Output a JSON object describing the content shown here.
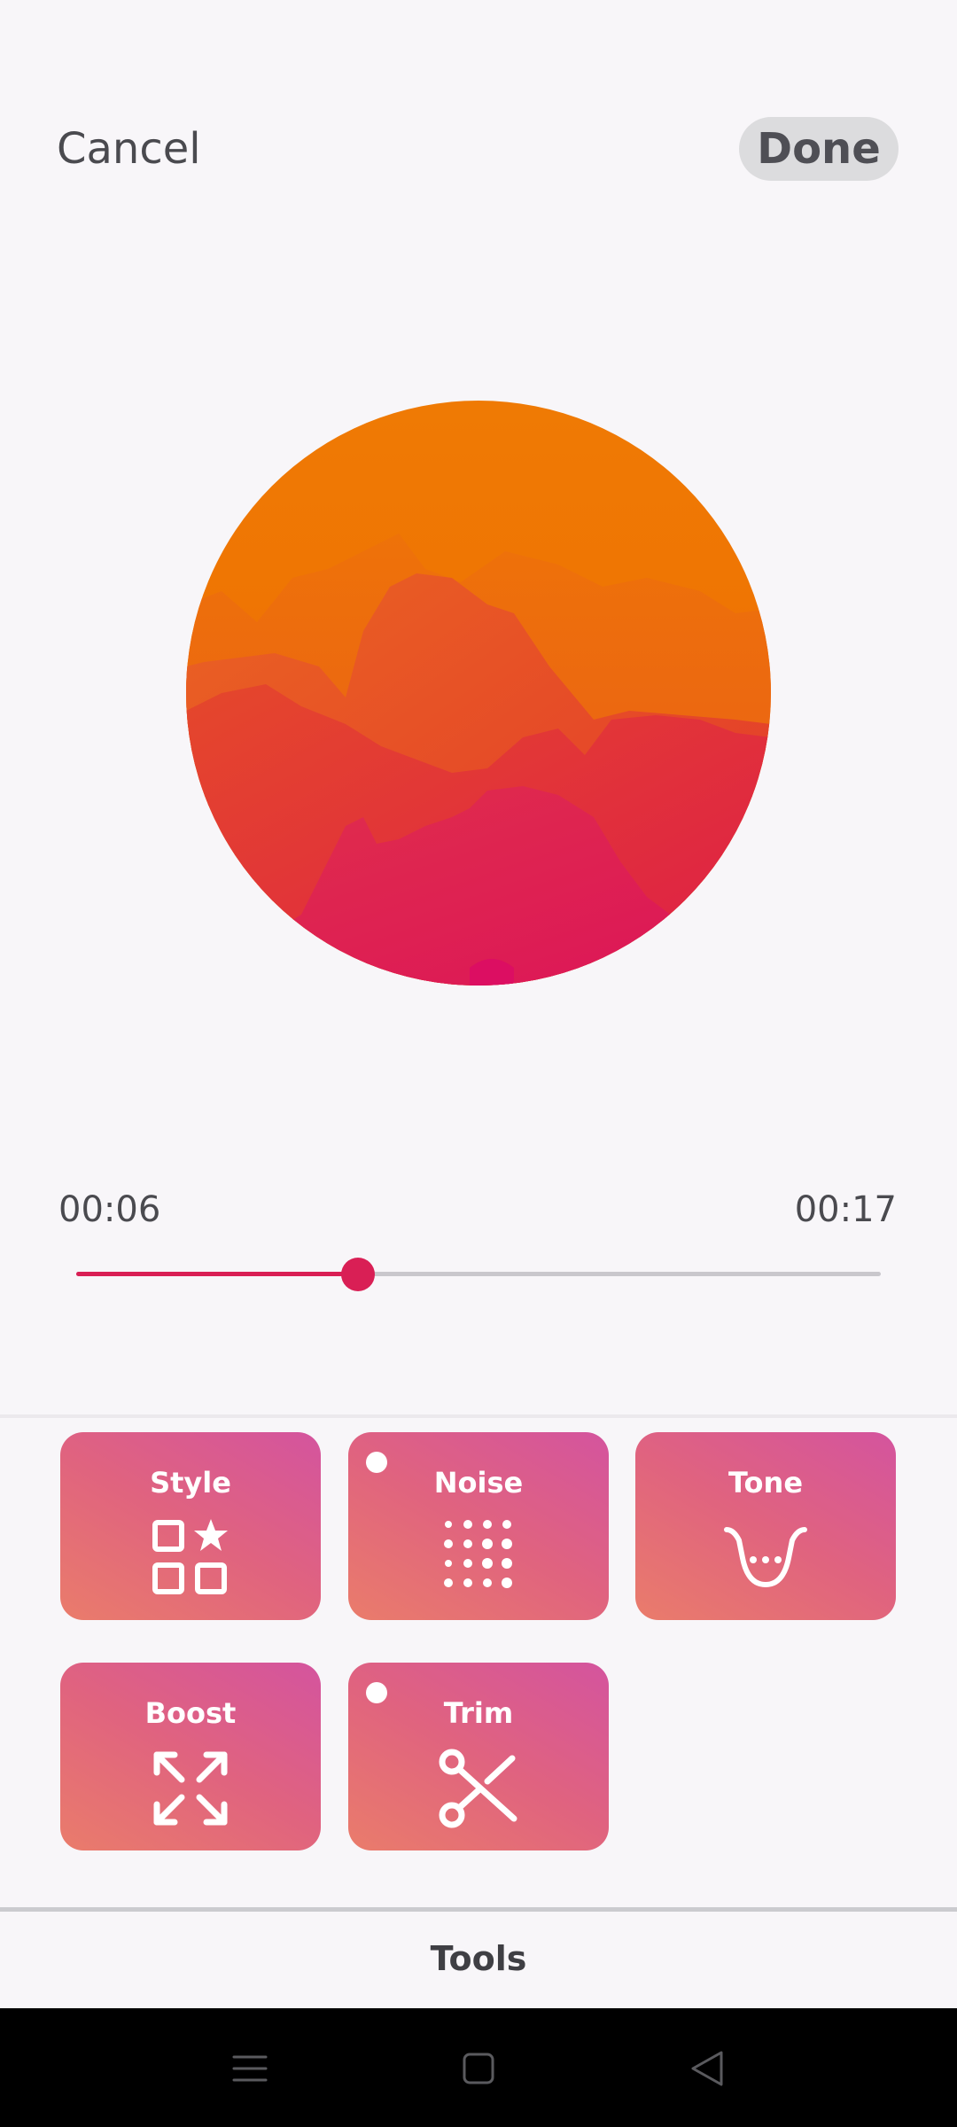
{
  "header": {
    "cancel_label": "Cancel",
    "done_label": "Done"
  },
  "artwork": {
    "icon": "abstract-mountain-sunset-art"
  },
  "player": {
    "current_time": "00:06",
    "total_time": "00:17",
    "progress_fraction": 0.35
  },
  "tools": {
    "items": [
      {
        "label": "Style",
        "icon": "style-grid-star-icon",
        "dot": false
      },
      {
        "label": "Noise",
        "icon": "noise-dots-icon",
        "dot": true
      },
      {
        "label": "Tone",
        "icon": "tone-curve-icon",
        "dot": false
      },
      {
        "label": "Boost",
        "icon": "expand-arrows-icon",
        "dot": false
      },
      {
        "label": "Trim",
        "icon": "scissors-icon",
        "dot": true
      }
    ]
  },
  "tabbar": {
    "active_tab": "Tools"
  },
  "colors": {
    "accent": "#d91f55",
    "tile_gradient_start": "#ea7c6b",
    "tile_gradient_end": "#d4549e",
    "background": "#f8f6f9"
  },
  "system_nav": {
    "menu_icon": "menu-icon",
    "home_icon": "home-square-icon",
    "back_icon": "back-triangle-icon"
  }
}
